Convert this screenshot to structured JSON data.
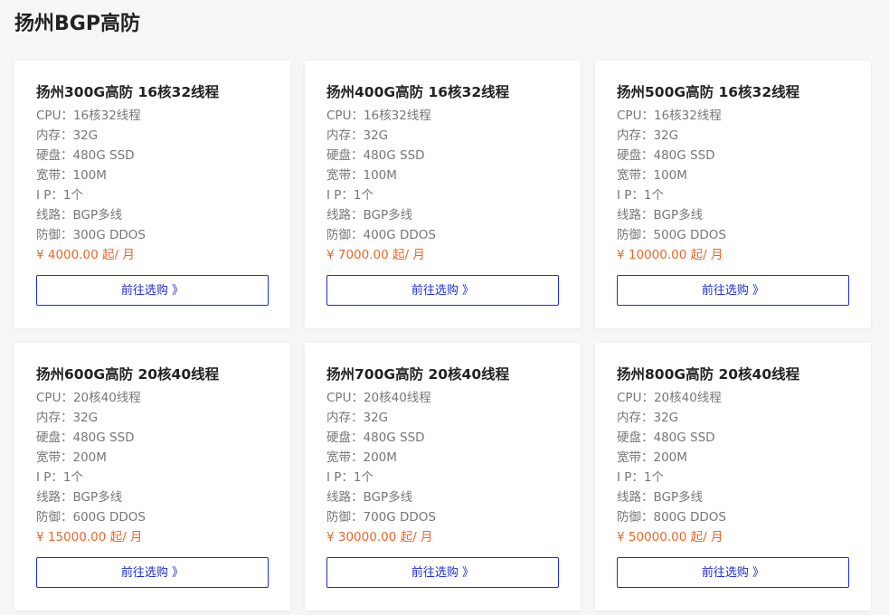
{
  "page": {
    "title": "扬州BGP高防"
  },
  "cards": [
    {
      "title": "扬州300G高防 16核32线程",
      "specs": [
        "CPU：16核32线程",
        "内存：32G",
        "硬盘：480G SSD",
        "宽带：100M",
        "I P：1个",
        "线路：BGP多线",
        "防御：300G DDOS"
      ],
      "price": "¥ 4000.00 起/ 月",
      "button": "前往选购 》"
    },
    {
      "title": "扬州400G高防 16核32线程",
      "specs": [
        "CPU：16核32线程",
        "内存：32G",
        "硬盘：480G SSD",
        "宽带：100M",
        "I P：1个",
        "线路：BGP多线",
        "防御：400G DDOS"
      ],
      "price": "¥ 7000.00 起/ 月",
      "button": "前往选购 》"
    },
    {
      "title": "扬州500G高防 16核32线程",
      "specs": [
        "CPU：16核32线程",
        "内存：32G",
        "硬盘：480G SSD",
        "宽带：100M",
        "I P：1个",
        "线路：BGP多线",
        "防御：500G DDOS"
      ],
      "price": "¥ 10000.00 起/ 月",
      "button": "前往选购 》"
    },
    {
      "title": "扬州600G高防 20核40线程",
      "specs": [
        "CPU：20核40线程",
        "内存：32G",
        "硬盘：480G SSD",
        "宽带：200M",
        "I P：1个",
        "线路：BGP多线",
        "防御：600G DDOS"
      ],
      "price": "¥ 15000.00 起/ 月",
      "button": "前往选购 》"
    },
    {
      "title": "扬州700G高防 20核40线程",
      "specs": [
        "CPU：20核40线程",
        "内存：32G",
        "硬盘：480G SSD",
        "宽带：200M",
        "I P：1个",
        "线路：BGP多线",
        "防御：700G DDOS"
      ],
      "price": "¥ 30000.00 起/ 月",
      "button": "前往选购 》"
    },
    {
      "title": "扬州800G高防 20核40线程",
      "specs": [
        "CPU：20核40线程",
        "内存：32G",
        "硬盘：480G SSD",
        "宽带：200M",
        "I P：1个",
        "线路：BGP多线",
        "防御：800G DDOS"
      ],
      "price": "¥ 50000.00 起/ 月",
      "button": "前往选购 》"
    }
  ],
  "colors": {
    "accent": "#1f2ecb",
    "price": "#e8692a",
    "background": "#f6f6f6"
  }
}
